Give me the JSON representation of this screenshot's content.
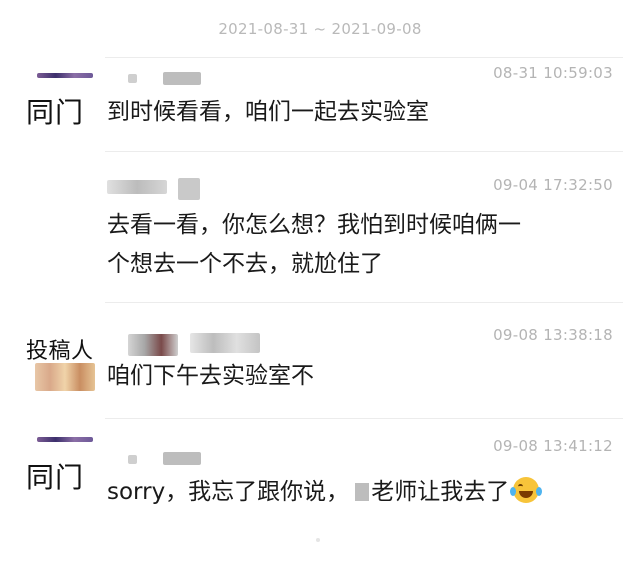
{
  "date_range": "2021-08-31 ~ 2021-09-08",
  "messages": [
    {
      "label": "同门",
      "time": "08-31 10:59:03",
      "lines": [
        "到时候看看，咱们一起去实验室"
      ]
    },
    {
      "label": "",
      "time": "09-04 17:32:50",
      "lines": [
        "去看一看，你怎么想？我怕到时候咱俩一",
        "个想去一个不去，就尬住了"
      ]
    },
    {
      "label": "投稿人",
      "time": "09-08 13:38:18",
      "lines": [
        "咱们下午去实验室不"
      ]
    },
    {
      "label": "同门",
      "time": "09-08 13:41:12",
      "text_before": "sorry，我忘了跟你说，",
      "text_after": "老师让我去了",
      "emoji": "tears-of-joy-emoji"
    }
  ],
  "colors": {
    "timestamp": "#b4b4b4",
    "text": "#1a1a1a",
    "separator": "#ececec",
    "emoji_face": "#f7c43a"
  }
}
